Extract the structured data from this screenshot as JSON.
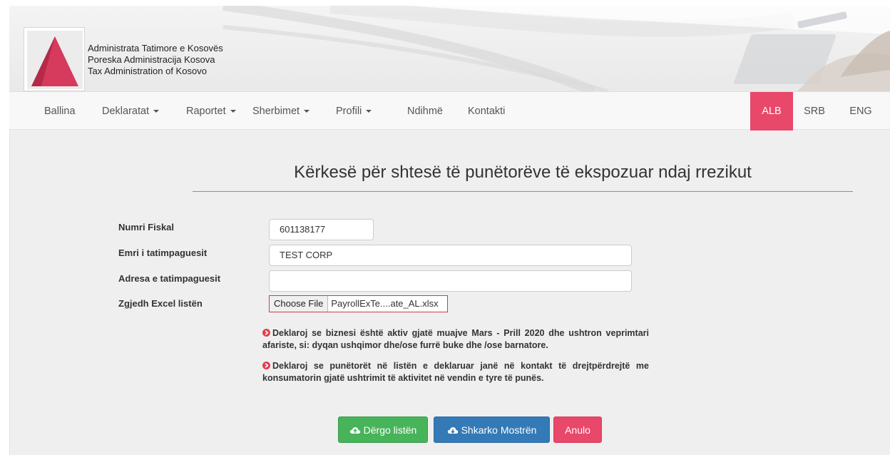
{
  "header": {
    "org_lines": [
      "Administrata Tatimore e Kosovës",
      "Poreska Administracija Kosova",
      "Tax Administration of Kosovo"
    ],
    "logo_icon": "atk-triangle-logo-icon"
  },
  "nav": {
    "items": [
      {
        "label": "Ballina",
        "dropdown": false
      },
      {
        "label": "Deklaratat",
        "dropdown": true
      },
      {
        "label": "Raportet",
        "dropdown": true
      },
      {
        "label": "Sherbimet",
        "dropdown": true
      },
      {
        "label": "Profili",
        "dropdown": true
      },
      {
        "label": "Ndihmë",
        "dropdown": false
      },
      {
        "label": "Kontakti",
        "dropdown": false
      }
    ],
    "languages": [
      "ALB",
      "SRB",
      "ENG"
    ],
    "active_language": "ALB"
  },
  "page": {
    "title": "Kërkesë për shtesë të punëtorëve të ekspozuar ndaj rrezikut"
  },
  "form": {
    "fiscal_number_label": "Numri Fiskal",
    "fiscal_number_value": "601138177",
    "taxpayer_name_label": "Emri i tatimpaguesit",
    "taxpayer_name_value": "TEST CORP",
    "taxpayer_address_label": "Adresa e tatimpaguesit",
    "taxpayer_address_value": "",
    "excel_label": "Zgjedh Excel listën",
    "choose_file_label": "Choose File",
    "file_name": "PayrollExTe....ate_AL.xlsx"
  },
  "declarations": [
    "Deklaroj se biznesi është aktiv gjatë muajve Mars - Prill 2020 dhe ushtron veprimtari afariste, si: dyqan ushqimor dhe/ose furrë buke dhe /ose barnatore.",
    "Deklaroj se punëtorët në listën e deklaruar janë në kontakt të drejtpërdrejtë me konsumatorin gjatë ushtrimit të aktivitet në vendin e tyre të punës."
  ],
  "buttons": {
    "send": "Dërgo listën",
    "download": "Shkarko Mostrën",
    "cancel": "Anulo"
  },
  "colors": {
    "accent": "#e8486a",
    "success": "#47b45a",
    "primary": "#337ab7",
    "decl_icon": "#e04050"
  }
}
